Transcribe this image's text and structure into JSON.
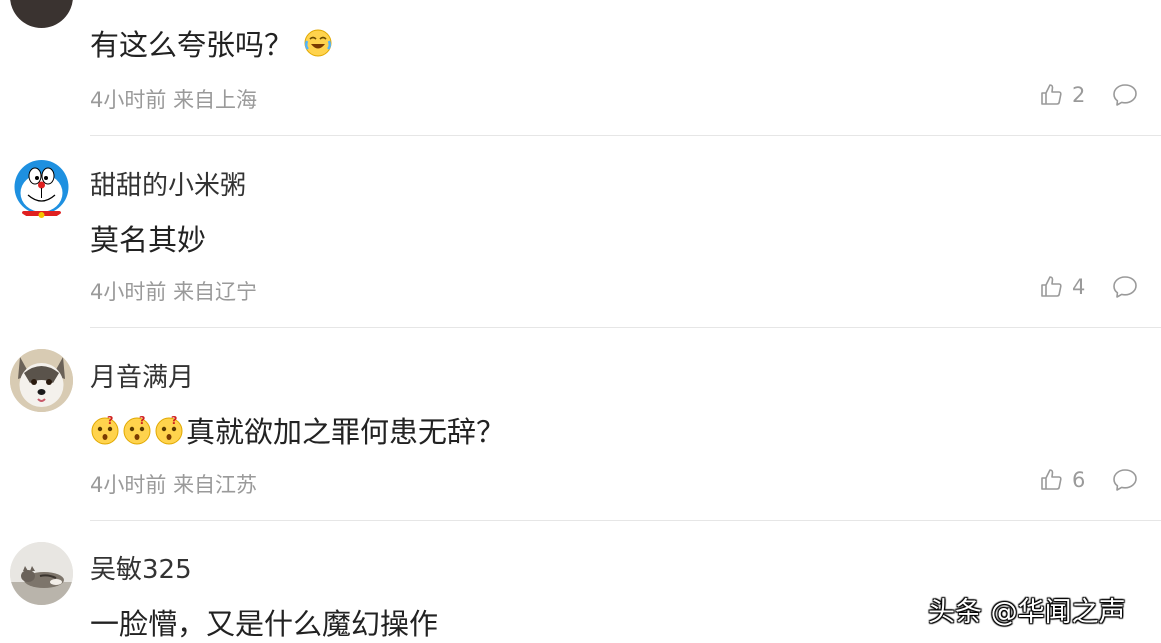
{
  "comments": [
    {
      "name": "",
      "content": "有这么夸张吗？",
      "emoji": "laugh-cry-emoji",
      "time": "4小时前",
      "location": "来自上海",
      "likes": "2"
    },
    {
      "name": "甜甜的小米粥",
      "content": "莫名其妙",
      "time": "4小时前",
      "location": "来自辽宁",
      "likes": "4"
    },
    {
      "name": "月音满月",
      "content": "真就欲加之罪何患无辞？",
      "emoji": "confused-emoji",
      "emoji_count": 3,
      "time": "4小时前",
      "location": "来自江苏",
      "likes": "6"
    },
    {
      "name": "吴敏325",
      "content": "一脸懵，又是什么魔幻操作"
    }
  ],
  "icons": {
    "like": "thumbs-up-icon",
    "reply": "comment-bubble-icon"
  },
  "colors": {
    "meta": "#9a9a9a",
    "divider": "#e6e6e6"
  },
  "watermark": "头条 @华闻之声"
}
